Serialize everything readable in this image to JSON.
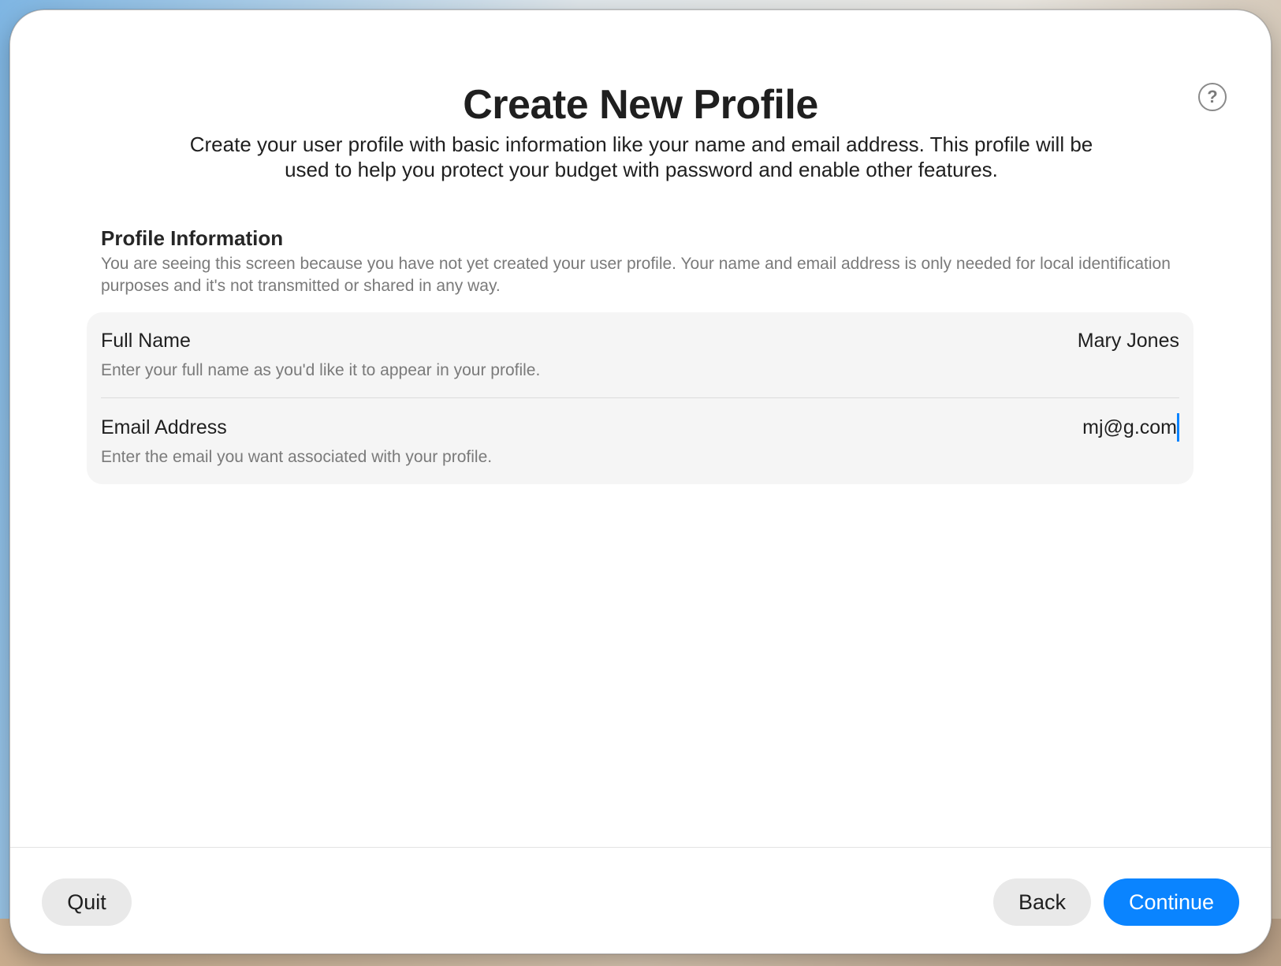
{
  "dialog": {
    "title": "Create New Profile",
    "subtitle": "Create your user profile with basic information like your name and email address. This profile will be used to help you protect your budget with password and enable other features.",
    "help_icon": "question-circle-icon",
    "help_symbol": "?"
  },
  "profile_section": {
    "title": "Profile Information",
    "description": "You are seeing this screen because you have not yet created your user profile. Your name and email address is only needed for local identification purposes and it's not transmitted or shared in any way.",
    "fields": [
      {
        "label": "Full Name",
        "hint": "Enter your full name as you'd like it to appear in your profile.",
        "value": "Mary Jones"
      },
      {
        "label": "Email Address",
        "hint": "Enter the email you want associated with your profile.",
        "value": "mj@g.com",
        "focused": true
      }
    ]
  },
  "footer": {
    "quit_label": "Quit",
    "back_label": "Back",
    "continue_label": "Continue"
  },
  "colors": {
    "accent": "#0a84ff",
    "card_background": "#f5f5f5",
    "secondary_text": "#7a7a7a"
  }
}
